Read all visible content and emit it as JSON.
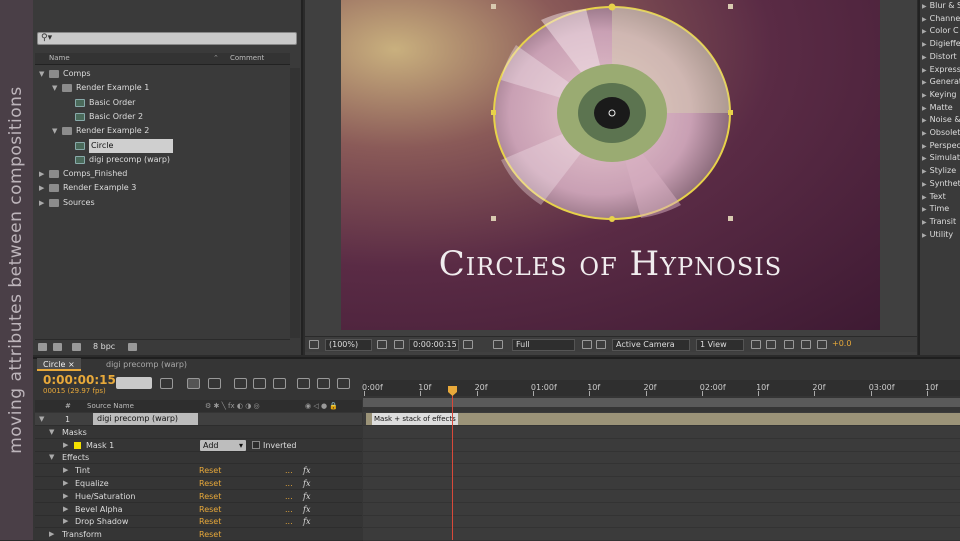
{
  "banner": {
    "text": "moving attributes between compositions"
  },
  "project": {
    "columns": {
      "name": "Name",
      "comment": "Comment"
    },
    "tree": [
      {
        "label": "Comps",
        "type": "folder",
        "depth": 0,
        "open": true
      },
      {
        "label": "Render Example 1",
        "type": "folder",
        "depth": 1,
        "open": true
      },
      {
        "label": "Basic Order",
        "type": "comp",
        "depth": 2
      },
      {
        "label": "Basic Order 2",
        "type": "comp",
        "depth": 2
      },
      {
        "label": "Render Example 2",
        "type": "folder",
        "depth": 1,
        "open": true
      },
      {
        "label": "Circle",
        "type": "comp",
        "depth": 2,
        "selected": true
      },
      {
        "label": "digi precomp (warp)",
        "type": "comp",
        "depth": 2
      },
      {
        "label": "Comps_Finished",
        "type": "folder",
        "depth": 0,
        "open": false
      },
      {
        "label": "Render Example 3",
        "type": "folder",
        "depth": 0,
        "open": false
      },
      {
        "label": "Sources",
        "type": "folder",
        "depth": 0,
        "open": false
      }
    ],
    "bpc": "8 bpc"
  },
  "viewer": {
    "title_text": "Circles of Hypnosis",
    "zoom": "(100%)",
    "timecode": "0:00:00:15",
    "resolution": "Full",
    "camera": "Active Camera",
    "views": "1 View",
    "exposure": "+0.0"
  },
  "effects_panel": {
    "items": [
      "Blur & S",
      "Channe",
      "Color C",
      "Digieffe",
      "Distort",
      "Express",
      "Generat",
      "Keying",
      "Matte",
      "Noise &",
      "Obsolet",
      "Perspec",
      "Simulat",
      "Stylize",
      "Synthet",
      "Text",
      "Time",
      "Transit",
      "Utility"
    ]
  },
  "timeline": {
    "tabs": {
      "active": "Circle",
      "inactive": "digi precomp (warp)"
    },
    "timecode": "0:00:00:15",
    "subcode": "00015 (29.97 fps)",
    "source_name_header": "Source Name",
    "layer": {
      "number": "1",
      "name": "digi precomp (warp)"
    },
    "masks_label": "Masks",
    "mask1": {
      "name": "Mask 1",
      "mode": "Add",
      "inverted_label": "Inverted"
    },
    "effects_label": "Effects",
    "effects": [
      "Tint",
      "Equalize",
      "Hue/Saturation",
      "Bevel Alpha",
      "Drop Shadow"
    ],
    "transform_label": "Transform",
    "reset_label": "Reset",
    "dots_label": "...",
    "fx_label": "fx",
    "ruler": [
      "0:00f",
      "10f",
      "20f",
      "01:00f",
      "10f",
      "20f",
      "02:00f",
      "10f",
      "20f",
      "03:00f",
      "10f"
    ],
    "layer_bar_label": "Mask + stack of effects"
  }
}
